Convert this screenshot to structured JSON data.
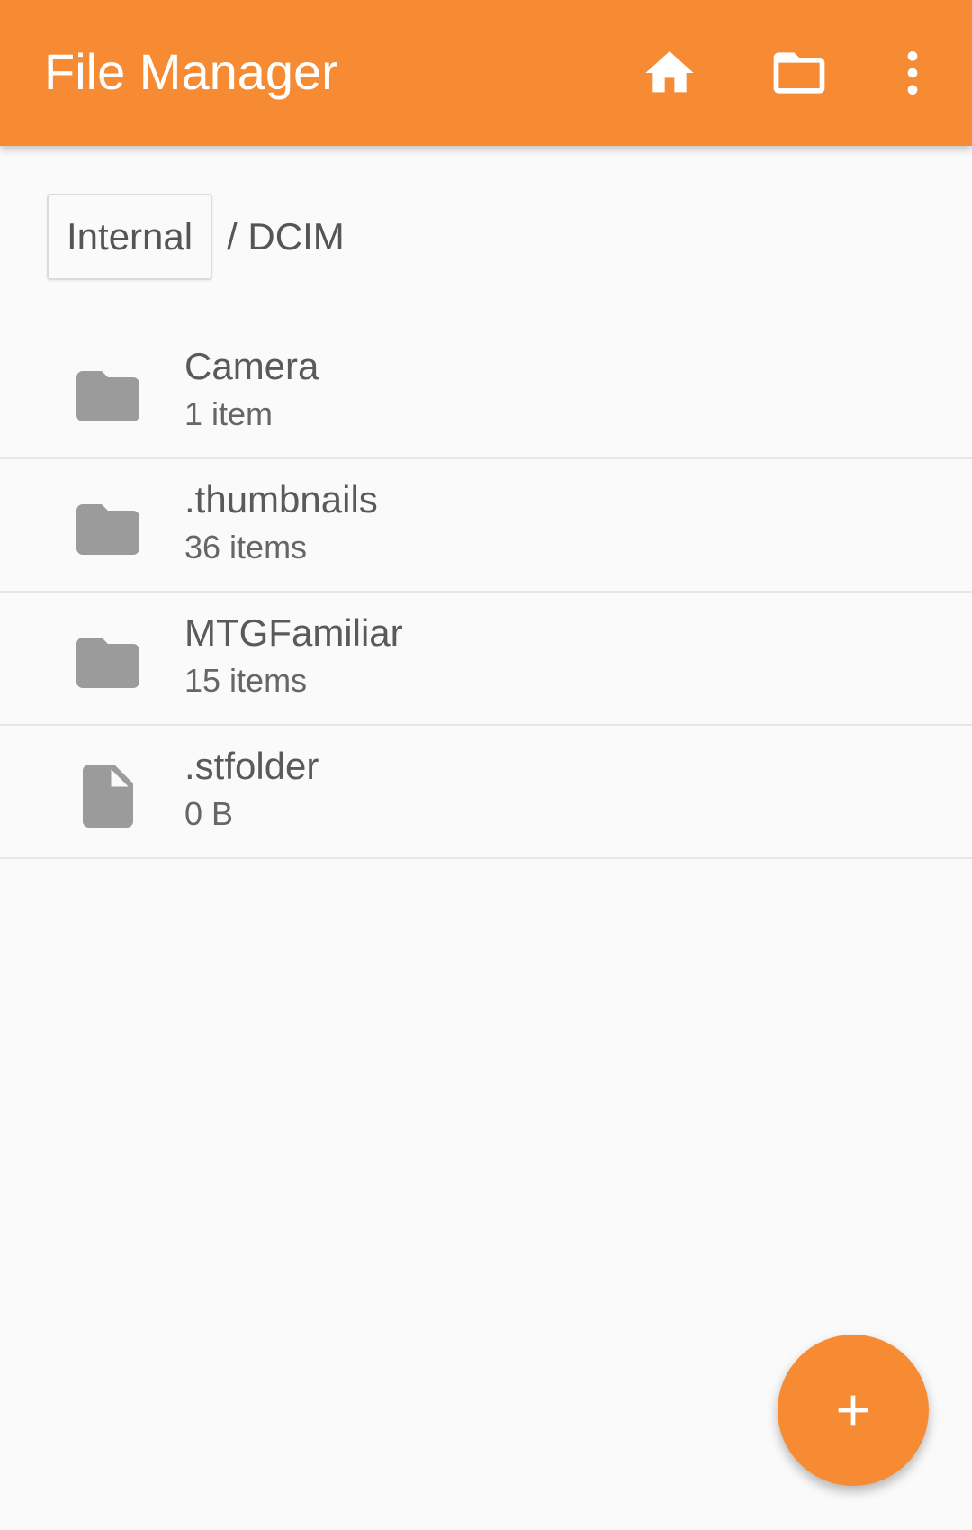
{
  "app_bar": {
    "title": "File Manager",
    "background_color": "#f68b33",
    "actions": [
      {
        "icon": "home-icon"
      },
      {
        "icon": "folder-icon"
      },
      {
        "icon": "more-vert-icon"
      }
    ]
  },
  "breadcrumb": {
    "root_label": "Internal",
    "path": "/ DCIM"
  },
  "files": [
    {
      "name": "Camera",
      "meta": "1 item",
      "type": "folder",
      "icon": "folder-icon"
    },
    {
      "name": ".thumbnails",
      "meta": "36 items",
      "type": "folder",
      "icon": "folder-icon"
    },
    {
      "name": "MTGFamiliar",
      "meta": "15 items",
      "type": "folder",
      "icon": "folder-icon"
    },
    {
      "name": ".stfolder",
      "meta": "0 B",
      "type": "file",
      "icon": "file-icon"
    }
  ],
  "fab": {
    "icon": "plus-icon",
    "color": "#f68b33"
  }
}
